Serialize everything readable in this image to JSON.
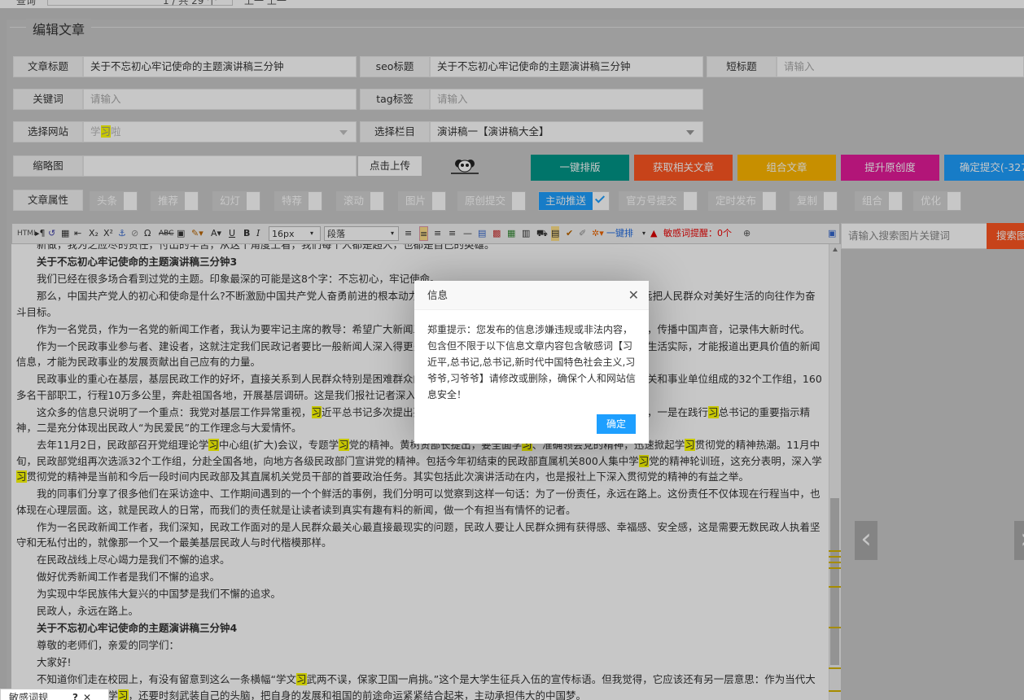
{
  "topbar": {
    "label": "查询",
    "page_info": "1 / 共 29 个",
    "nav": "上一  上一"
  },
  "form": {
    "legend": "编辑文章",
    "title_label": "文章标题",
    "title_value": "关于不忘初心牢记使命的主题演讲稿三分钟",
    "seo_label": "seo标题",
    "seo_value": "关于不忘初心牢记使命的主题演讲稿三分钟",
    "short_label": "短标题",
    "short_placeholder": "请输入",
    "keyword_label": "关键词",
    "keyword_placeholder": "请输入",
    "tag_label": "tag标签",
    "tag_placeholder": "请输入",
    "site_label": "选择网站",
    "site_value_pre": "学",
    "site_value_hl": "习",
    "site_value_post": "啦",
    "column_label": "选择栏目",
    "column_value": "演讲稿一【演讲稿大全】",
    "thumb_label": "缩略图",
    "upload_label": "点击上传",
    "attr_label": "文章属性"
  },
  "actions": [
    {
      "label": "一键排版",
      "color": "#009688"
    },
    {
      "label": "获取相关文章",
      "color": "#ff5722"
    },
    {
      "label": "组合文章",
      "color": "#ffb800"
    },
    {
      "label": "提升原创度",
      "color": "#e51b9a"
    },
    {
      "label": "确定提交(-327",
      "color": "#1e9fff"
    }
  ],
  "attributes": [
    {
      "label": "头条",
      "on": false
    },
    {
      "label": "推荐",
      "on": false
    },
    {
      "label": "幻灯",
      "on": false
    },
    {
      "label": "特荐",
      "on": false
    },
    {
      "label": "滚动",
      "on": false
    },
    {
      "label": "图片",
      "on": false
    },
    {
      "label": "原创提交",
      "on": false
    },
    {
      "label": "主动推送",
      "on": true
    },
    {
      "label": "官方号提交",
      "on": false
    },
    {
      "label": "定时发布",
      "on": false
    },
    {
      "label": "复制",
      "on": false
    },
    {
      "label": "组合",
      "on": false
    },
    {
      "label": "优化",
      "on": false
    }
  ],
  "toolbar": {
    "font_size": "16px",
    "paragraph": "段落",
    "one_key": "一键排",
    "sensitive": "敏感词提醒：0个"
  },
  "sidebar": {
    "search_placeholder": "请输入搜索图片关键词",
    "search_button": "搜索图"
  },
  "dialog": {
    "title": "信息",
    "message": "郑重提示：您发布的信息涉嫌违规或非法内容，包含但不限于以下信息文章内容包含敏感词【习近平,总书记,总书记,新时代中国特色社会主义,习爷爷,习爷爷】请修改或删除，确保个人和网站信息安全！",
    "ok": "确定"
  },
  "bottom": {
    "sensitive_tab": "敏感词规"
  },
  "article": [
    {
      "bold": false,
      "segs": [
        {
          "t": "新做，我为之应尽的责任，付出的辛苦，从这个角度上看，我们每个人都是超人，也都是自己的英雄。"
        }
      ]
    },
    {
      "bold": true,
      "segs": [
        {
          "t": "关于不忘初心牢记使命的主题演讲稿三分钟3"
        }
      ]
    },
    {
      "bold": false,
      "segs": [
        {
          "t": "我们已经在很多场合看到过党的主题。印象最深的可能是这8个字：不忘初心，牢记使命。"
        }
      ]
    },
    {
      "bold": false,
      "segs": [
        {
          "t": "那么，中国共产党人的初心和使命是什么?不断激励中国共产党人奋勇前进的根本动力，就是为中国人民谋幸福，为中华民族谋复兴。永远把人民群众对美好生活的向往作为奋斗目标。"
        }
      ]
    },
    {
      "bold": false,
      "segs": [
        {
          "t": "作为一名党员，作为一名党的新闻工作者，我认为要牢记主席的教导：希望广大新闻工作者增强脚力、眼力、脑力、笔力，讲好中国故事，传播中国声音，记录伟大新时代。"
        }
      ]
    },
    {
      "bold": false,
      "segs": [
        {
          "t": "作为一个民政事业参与者、建设者，这就注定我们民政记者要比一般新闻人深入得更多，走得更远，只有深入了解困难群众和特殊群体的生活实际，才能报道出更具价值的新闻信息，才能为民政事业的发展贡献出自己应有的力量。"
        }
      ]
    },
    {
      "bold": false,
      "segs": [
        {
          "t": "民政事业的重心在基层，基层民政工作的好坏，直接关系到人民群众特别是困难群众的切身利益。今年，民政部组织部机关司局和直属机关和事业单位组成的32个工作组，160多名干部职工，行程10万多公里，奔赴祖国各地，开展基层调研。这是我们报社记者深入一线采访，获取第一手新闻信息。"
        }
      ]
    },
    {
      "bold": false,
      "segs": [
        {
          "t": "这众多的信息只说明了一个重点：我党对基层工作异常重视，"
        },
        {
          "t": "习",
          "h": true
        },
        {
          "t": "近平总书记多次提出要求，民政部的这一调研活动是推进民政工作的行动，一是在践行"
        },
        {
          "t": "习",
          "h": true
        },
        {
          "t": "总书记的重要指示精神，二是充分体现出民政人“为民爱民”的工作理念与大爱情怀。"
        }
      ]
    },
    {
      "bold": false,
      "segs": [
        {
          "t": "去年11月2日，民政部召开党组理论学"
        },
        {
          "t": "习",
          "h": true
        },
        {
          "t": "中心组(扩大)会议，专题学"
        },
        {
          "t": "习",
          "h": true
        },
        {
          "t": "党的精神。黄树贤部长提出，要全面学"
        },
        {
          "t": "习",
          "h": true
        },
        {
          "t": "、准确领会党的精神，迅速掀起学"
        },
        {
          "t": "习",
          "h": true
        },
        {
          "t": "贯彻党的精神热潮。11月中旬，民政部党组再次选派32个工作组，分赴全国各地，向地方各级民政部门宣讲党的精神。包括今年初结束的民政部直属机关800人集中学"
        },
        {
          "t": "习",
          "h": true
        },
        {
          "t": "党的精神轮训班，这充分表明，深入学"
        },
        {
          "t": "习",
          "h": true
        },
        {
          "t": "贯彻党的精神是当前和今后一段时间内民政部及其直属机关党员干部的首要政治任务。其实包括此次演讲活动在内，也是报社上下深入贯彻党的精神的有益之举。"
        }
      ]
    },
    {
      "bold": false,
      "segs": [
        {
          "t": "我的同事们分享了很多他们在采访途中、工作期间遇到的一个个鲜活的事例，我们分明可以觉察到这样一句话：为了一份责任，永远在路上。这份责任不仅体现在行程当中，也体现在心理层面。这，就是民政人的日常，而我们的责任就是让读者读到真实有趣有料的新闻，做一个有担当有情怀的记者。"
        }
      ]
    },
    {
      "bold": false,
      "segs": [
        {
          "t": "作为一名民政新闻工作者，我们深知，民政工作面对的是人民群众最关心最直接最现实的问题，民政人要让人民群众拥有获得感、幸福感、安全感，这是需要无数民政人执着坚守和无私付出的，就像那一个又一个最美基层民政人与时代楷模那样。"
        }
      ]
    },
    {
      "bold": false,
      "segs": [
        {
          "t": "在民政战线上尽心竭力是我们不懈的追求。"
        }
      ]
    },
    {
      "bold": false,
      "segs": [
        {
          "t": "做好优秀新闻工作者是我们不懈的追求。"
        }
      ]
    },
    {
      "bold": false,
      "segs": [
        {
          "t": "为实现中华民族伟大复兴的中国梦是我们不懈的追求。"
        }
      ]
    },
    {
      "bold": false,
      "segs": [
        {
          "t": "民政人，永远在路上。"
        }
      ]
    },
    {
      "bold": true,
      "segs": [
        {
          "t": "关于不忘初心牢记使命的主题演讲稿三分钟4"
        }
      ]
    },
    {
      "bold": false,
      "segs": [
        {
          "t": "尊敬的老师们，亲爱的同学们："
        }
      ]
    },
    {
      "bold": false,
      "segs": [
        {
          "t": "大家好!"
        }
      ]
    },
    {
      "bold": false,
      "segs": [
        {
          "t": "不知道你们走在校园上，有没有留意到这么一条横幅“学文"
        },
        {
          "t": "习",
          "h": true
        },
        {
          "t": "武两不误，保家卫国一肩挑。”这个是大学生征兵入伍的宣传标语。但我觉得，它应该还有另一层意思：作为当代大学生，除了学业上的学"
        },
        {
          "t": "习",
          "h": true
        },
        {
          "t": "，还要时刻武装自己的头脑，把自身的发展和祖国的前途命运紧紧结合起来，主动承担伟大的中国梦。"
        }
      ]
    }
  ]
}
